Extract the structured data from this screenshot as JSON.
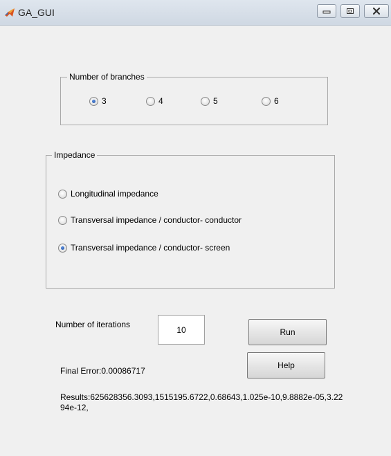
{
  "window": {
    "title": "GA_GUI",
    "controls": {
      "minimize": "minimize-icon",
      "maximize": "maximize-icon",
      "close": "close-icon"
    }
  },
  "branches_panel": {
    "title": "Number of branches",
    "options": [
      "3",
      "4",
      "5",
      "6"
    ],
    "selected": "3"
  },
  "impedance_panel": {
    "title": "Impedance",
    "options": [
      "Longitudinal impedance",
      "Transversal impedance / conductor- conductor",
      "Transversal impedance / conductor- screen"
    ],
    "selected": "Transversal impedance / conductor- screen"
  },
  "iterations": {
    "label": "Number of iterations",
    "value": "10"
  },
  "buttons": {
    "run": "Run",
    "help": "Help"
  },
  "final_error": "Final Error:0.00086717",
  "results": "Results:625628356.3093,1515195.6722,0.68643,1.025e-10,9.8882e-05,3.2294e-12,",
  "colors": {
    "background": "#f0f0f0",
    "radio_selected": "#1f4f9e"
  }
}
